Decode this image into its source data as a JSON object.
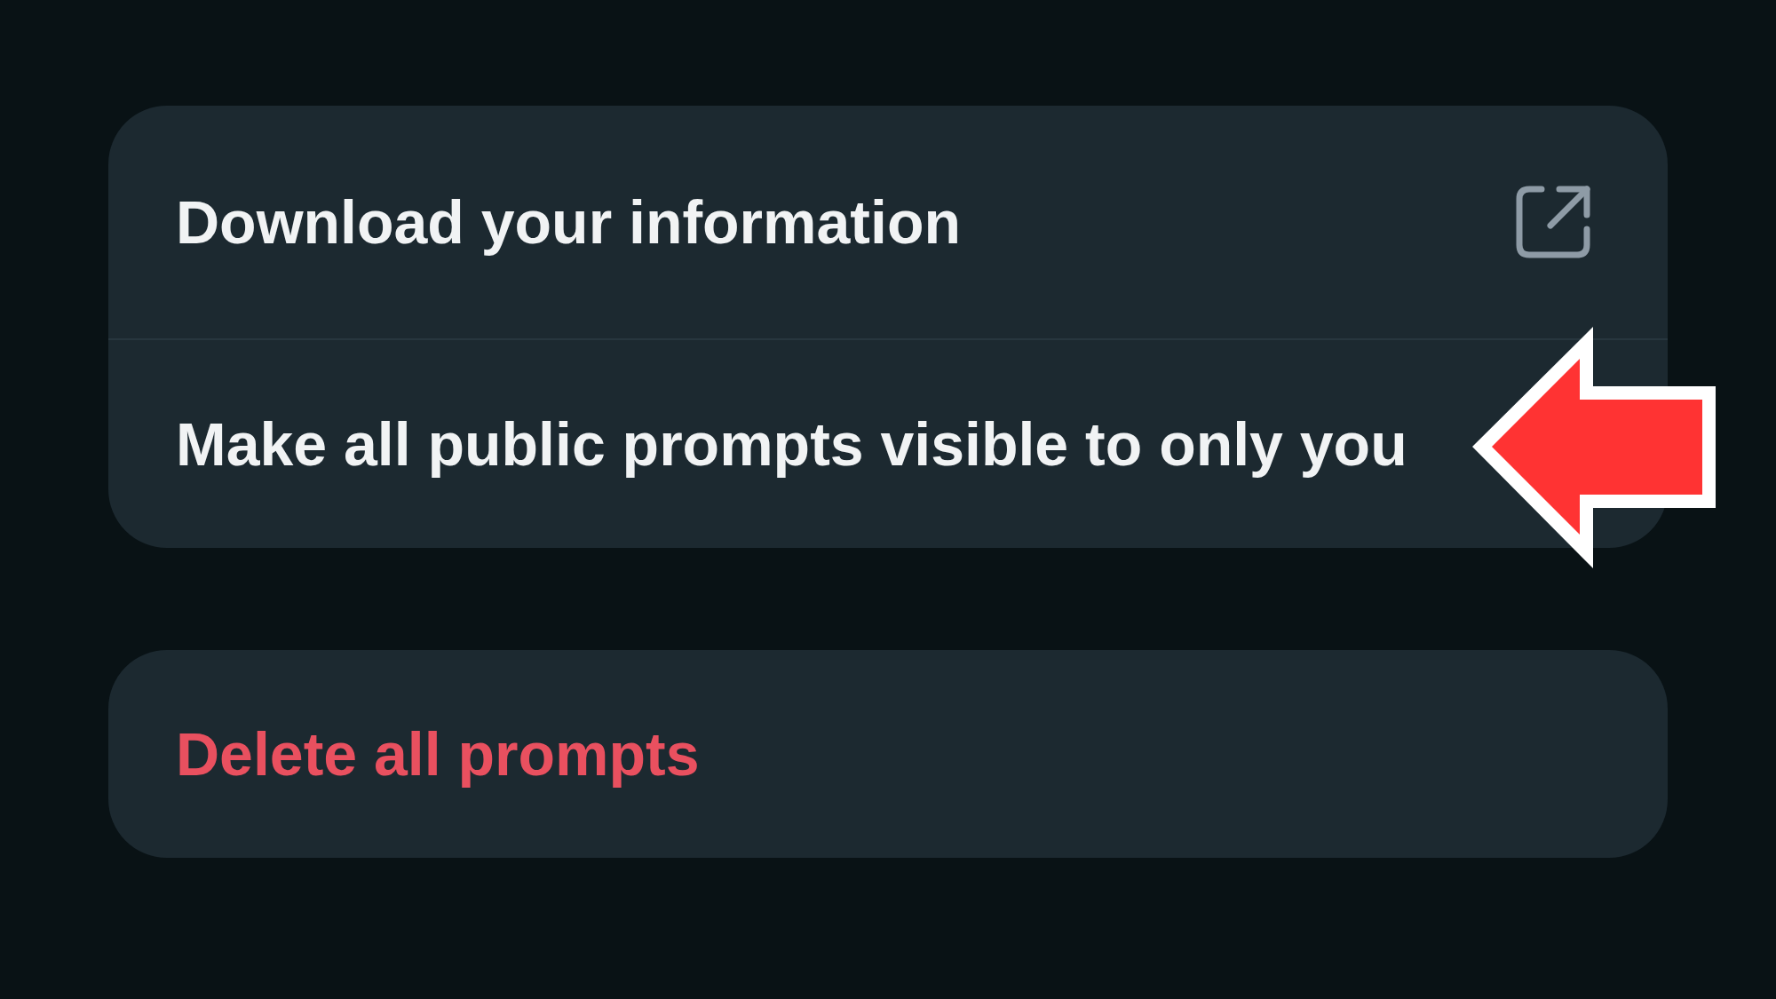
{
  "groups": [
    {
      "items": [
        {
          "label": "Download your information",
          "kind": "external"
        },
        {
          "label": "Make all public prompts visible to only you",
          "kind": "action"
        }
      ]
    },
    {
      "items": [
        {
          "label": "Delete all prompts",
          "kind": "destructive"
        }
      ]
    }
  ],
  "annotations": [
    {
      "kind": "arrow"
    }
  ]
}
